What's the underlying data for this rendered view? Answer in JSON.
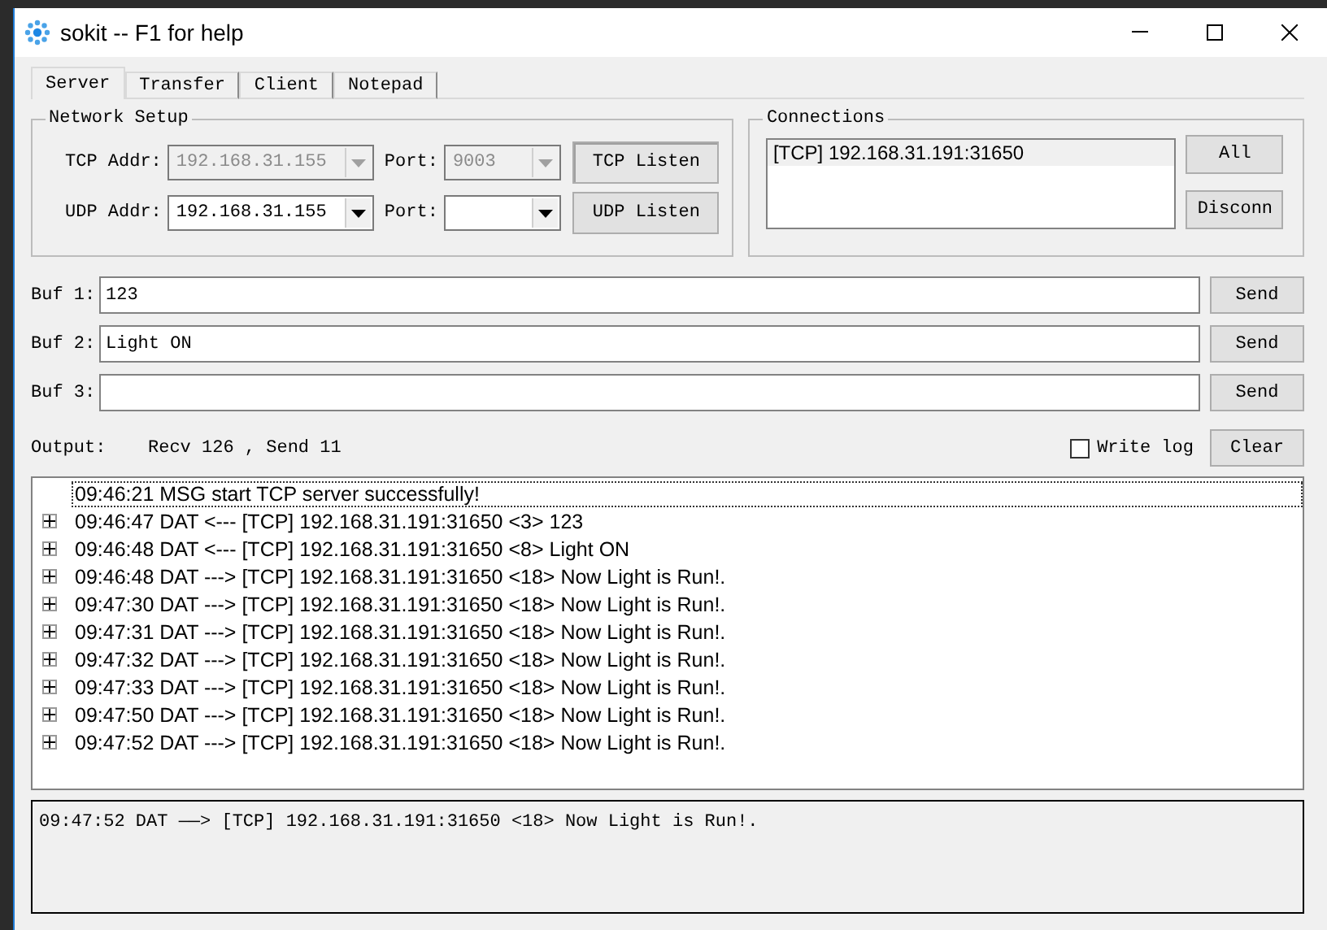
{
  "window": {
    "title": "sokit -- F1 for help"
  },
  "tabs": [
    {
      "label": "Server",
      "selected": true
    },
    {
      "label": "Transfer",
      "selected": false
    },
    {
      "label": "Client",
      "selected": false
    },
    {
      "label": "Notepad",
      "selected": false
    }
  ],
  "network_setup": {
    "title": "Network Setup",
    "rows": [
      {
        "addr_label": "TCP Addr:",
        "addr": "192.168.31.155",
        "port_label": "Port:",
        "port": "9003",
        "disabled": true,
        "button": "TCP Listen",
        "pressed": true
      },
      {
        "addr_label": "UDP Addr:",
        "addr": "192.168.31.155",
        "port_label": "Port:",
        "disabled": false,
        "button": "UDP Listen",
        "pressed": false
      }
    ]
  },
  "connections": {
    "title": "Connections",
    "items": [
      {
        "text": "[TCP] 192.168.31.191:31650",
        "selected": true
      }
    ],
    "buttons": [
      "All",
      "Disconn"
    ]
  },
  "buffers": [
    {
      "label": "Buf 1:",
      "value": "123",
      "button": "Send"
    },
    {
      "label": "Buf 2:",
      "value": "Light ON",
      "button": "Send"
    },
    {
      "label": "Buf 3:",
      "button": "Send"
    }
  ],
  "output": {
    "label": "Output:",
    "stats": "Recv 126 , Send 11"
  },
  "write_log": {
    "label": "Write log",
    "checked": false
  },
  "clear_button": "Clear",
  "log": [
    {
      "kind": "message",
      "text": "09:46:21 MSG start TCP server successfully!",
      "selected": true
    },
    {
      "kind": "data",
      "text": "09:46:47 DAT <--- [TCP] 192.168.31.191:31650 <3> 123",
      "selected": false
    },
    {
      "kind": "data",
      "text": "09:46:48 DAT <--- [TCP] 192.168.31.191:31650 <8> Light ON",
      "selected": false
    },
    {
      "kind": "data",
      "text": "09:46:48 DAT ---> [TCP] 192.168.31.191:31650 <18> Now Light is Run!.",
      "selected": false
    },
    {
      "kind": "data",
      "text": "09:47:30 DAT ---> [TCP] 192.168.31.191:31650 <18> Now Light is Run!.",
      "selected": false
    },
    {
      "kind": "data",
      "text": "09:47:31 DAT ---> [TCP] 192.168.31.191:31650 <18> Now Light is Run!.",
      "selected": false
    },
    {
      "kind": "data",
      "text": "09:47:32 DAT ---> [TCP] 192.168.31.191:31650 <18> Now Light is Run!.",
      "selected": false
    },
    {
      "kind": "data",
      "text": "09:47:33 DAT ---> [TCP] 192.168.31.191:31650 <18> Now Light is Run!.",
      "selected": false
    },
    {
      "kind": "data",
      "text": "09:47:50 DAT ---> [TCP] 192.168.31.191:31650 <18> Now Light is Run!.",
      "selected": false
    },
    {
      "kind": "data",
      "text": "09:47:52 DAT ---> [TCP] 192.168.31.191:31650 <18> Now Light is Run!.",
      "selected": false
    }
  ],
  "detail": "09:47:52 DAT ——> [TCP] 192.168.31.191:31650 <18> Now Light is Run!."
}
